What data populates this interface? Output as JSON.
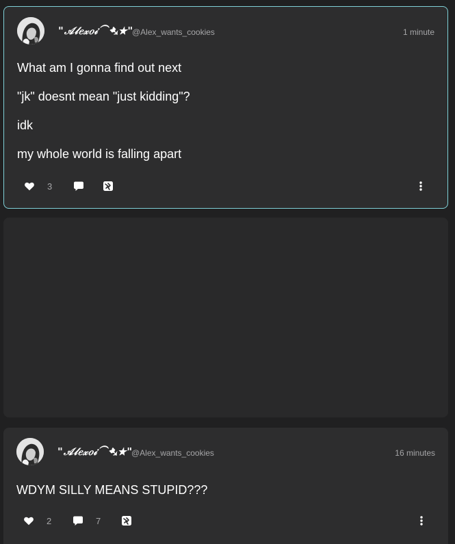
{
  "posts": [
    {
      "display_name": "\"𝒜𝓁𝑒𝓍𝑜𝒾⁀➷★\"",
      "handle": "@Alex_wants_cookies",
      "time": "1 minute",
      "lines": [
        "What am I gonna find out next",
        "\"jk\" doesnt mean \"just kidding\"?",
        "idk",
        "my whole world is falling apart"
      ],
      "likes": "3",
      "comments": "",
      "selected": true
    },
    {
      "display_name": "\"𝒜𝓁𝑒𝓍𝑜𝒾⁀➷★\"",
      "handle": "@Alex_wants_cookies",
      "time": "16 minutes",
      "lines": [
        "WDYM SILLY MEANS STUPID???"
      ],
      "likes": "2",
      "comments": "7",
      "selected": false
    }
  ],
  "icons": {
    "like": "heart-icon",
    "comment": "comment-icon",
    "share": "share-icon",
    "more": "more-options-icon"
  },
  "colors": {
    "page_background": "#202021",
    "card_background": "#2d2d2e",
    "selected_border": "#7fd1d8",
    "muted_text": "#a6a6a8"
  }
}
